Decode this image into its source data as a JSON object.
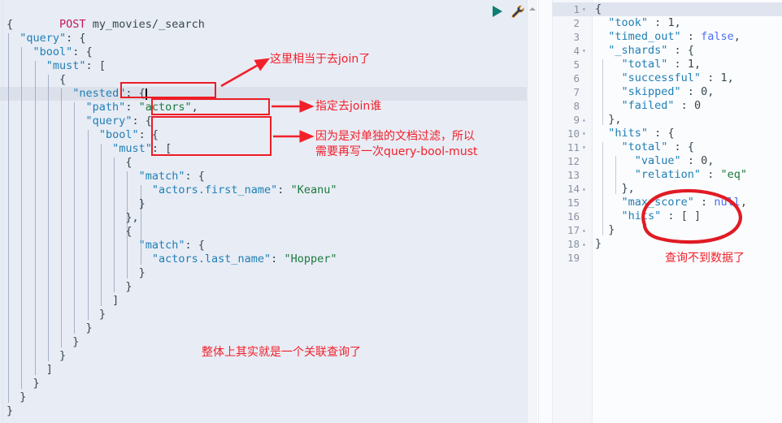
{
  "request": {
    "method": "POST",
    "endpoint": "my_movies/_search",
    "lines": [
      {
        "indent": 0,
        "text": "{"
      },
      {
        "indent": 1,
        "key": "\"query\"",
        "text": "\"query\": {"
      },
      {
        "indent": 2,
        "key": "\"bool\"",
        "text": "\"bool\": {"
      },
      {
        "indent": 3,
        "key": "\"must\"",
        "text": "\"must\": ["
      },
      {
        "indent": 4,
        "text": "{"
      },
      {
        "indent": 5,
        "key": "\"nested\"",
        "text": "\"nested\": {"
      },
      {
        "indent": 6,
        "key": "\"path\"",
        "value": "\"actors\"",
        "text": "\"path\": \"actors\","
      },
      {
        "indent": 6,
        "key": "\"query\"",
        "text": "\"query\": {"
      },
      {
        "indent": 7,
        "key": "\"bool\"",
        "text": "\"bool\": {"
      },
      {
        "indent": 8,
        "key": "\"must\"",
        "text": "\"must\": ["
      },
      {
        "indent": 9,
        "text": "{"
      },
      {
        "indent": 10,
        "key": "\"match\"",
        "text": "\"match\": {"
      },
      {
        "indent": 11,
        "key": "\"actors.first_name\"",
        "value": "\"Keanu\"",
        "text": "\"actors.first_name\": \"Keanu\""
      },
      {
        "indent": 10,
        "text": "}"
      },
      {
        "indent": 9,
        "text": "},"
      },
      {
        "indent": 9,
        "text": "{"
      },
      {
        "indent": 10,
        "key": "\"match\"",
        "text": "\"match\": {"
      },
      {
        "indent": 11,
        "key": "\"actors.last_name\"",
        "value": "\"Hopper\"",
        "text": "\"actors.last_name\": \"Hopper\""
      },
      {
        "indent": 10,
        "text": "}"
      },
      {
        "indent": 9,
        "text": "}"
      },
      {
        "indent": 8,
        "text": "]"
      },
      {
        "indent": 7,
        "text": "}"
      },
      {
        "indent": 6,
        "text": "}"
      },
      {
        "indent": 5,
        "text": "}"
      },
      {
        "indent": 4,
        "text": "}"
      },
      {
        "indent": 3,
        "text": "]"
      },
      {
        "indent": 2,
        "text": "}"
      },
      {
        "indent": 1,
        "text": "}"
      },
      {
        "indent": 0,
        "text": "}"
      }
    ],
    "active_line_index": 5,
    "toolbar": {
      "run_label": "run-request",
      "wrench_label": "settings"
    }
  },
  "response": {
    "lines": [
      {
        "num": "1",
        "fold": "▾",
        "text": "{"
      },
      {
        "num": "2",
        "fold": "",
        "text": "  \"took\" : 1,"
      },
      {
        "num": "3",
        "fold": "",
        "text": "  \"timed_out\" : false,"
      },
      {
        "num": "4",
        "fold": "▾",
        "text": "  \"_shards\" : {"
      },
      {
        "num": "5",
        "fold": "",
        "text": "    \"total\" : 1,"
      },
      {
        "num": "6",
        "fold": "",
        "text": "    \"successful\" : 1,"
      },
      {
        "num": "7",
        "fold": "",
        "text": "    \"skipped\" : 0,"
      },
      {
        "num": "8",
        "fold": "",
        "text": "    \"failed\" : 0"
      },
      {
        "num": "9",
        "fold": "▴",
        "text": "  },"
      },
      {
        "num": "10",
        "fold": "▾",
        "text": "  \"hits\" : {"
      },
      {
        "num": "11",
        "fold": "▾",
        "text": "    \"total\" : {"
      },
      {
        "num": "12",
        "fold": "",
        "text": "      \"value\" : 0,"
      },
      {
        "num": "13",
        "fold": "",
        "text": "      \"relation\" : \"eq\""
      },
      {
        "num": "14",
        "fold": "▴",
        "text": "    },"
      },
      {
        "num": "15",
        "fold": "",
        "text": "    \"max_score\" : null,"
      },
      {
        "num": "16",
        "fold": "",
        "text": "    \"hits\" : [ ]"
      },
      {
        "num": "17",
        "fold": "▴",
        "text": "  }"
      },
      {
        "num": "18",
        "fold": "▴",
        "text": "}"
      },
      {
        "num": "19",
        "fold": "",
        "text": ""
      }
    ],
    "active_line_index": 0
  },
  "annotations": {
    "accent_color": "#f2202a",
    "notes": [
      {
        "id": "note-join",
        "text": "这里相当于去join了"
      },
      {
        "id": "note-join-who",
        "text": "指定去join谁"
      },
      {
        "id": "note-rewrite-1",
        "text": "因为是对单独的文档过滤，所以"
      },
      {
        "id": "note-rewrite-2",
        "text": "需要再写一次query-bool-must"
      },
      {
        "id": "note-overall",
        "text": "整体上其实就是一个关联查询了"
      },
      {
        "id": "note-no-data",
        "text": "查询不到数据了"
      }
    ]
  }
}
